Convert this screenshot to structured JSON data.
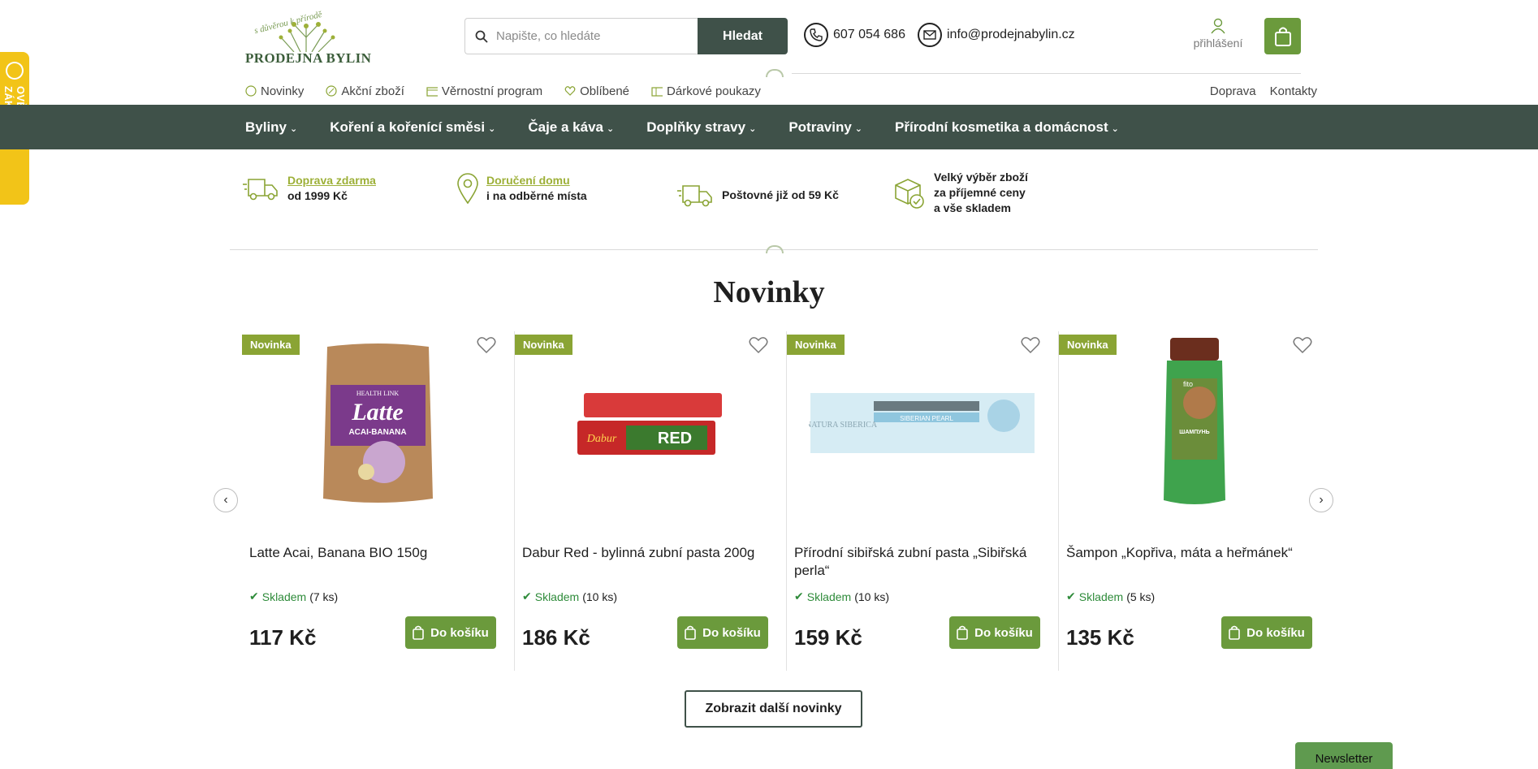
{
  "verified_tab": {
    "label": "OVĚŘENO ZÁKAZNÍKY"
  },
  "logo": {
    "name": "PRODEJNA BYLIN",
    "motto": "s důvěrou k přírodě"
  },
  "search": {
    "placeholder": "Napište, co hledáte",
    "button": "Hledat"
  },
  "contact": {
    "phone": "607 054 686",
    "email": "info@prodejnabylin.cz"
  },
  "login": {
    "label": "přihlášení"
  },
  "subnav": {
    "items": [
      {
        "label": "Novinky",
        "icon": "new-icon"
      },
      {
        "label": "Akční zboží",
        "icon": "percent-icon"
      },
      {
        "label": "Věrnostní program",
        "icon": "loyalty-icon"
      },
      {
        "label": "Oblíbené",
        "icon": "heart-icon"
      },
      {
        "label": "Dárkové poukazy",
        "icon": "voucher-icon"
      }
    ],
    "right": [
      "Doprava",
      "Kontakty"
    ]
  },
  "mainnav": {
    "items": [
      "Byliny",
      "Koření a kořenící směsi",
      "Čaje a káva",
      "Doplňky stravy",
      "Potraviny",
      "Přírodní kosmetika a domácnost"
    ]
  },
  "benefits": [
    {
      "link": "Doprava zdarma",
      "text": "od 1999 Kč",
      "icon": "truck-icon"
    },
    {
      "link": "Doručení domu",
      "text": "i na odběrné místa",
      "icon": "location-pin-icon"
    },
    {
      "text": "Poštovné již od 59 Kč",
      "icon": "truck-icon"
    },
    {
      "line1": "Velký výběr zboží",
      "line2": "za příjemné ceny",
      "line3": "a vše skladem",
      "icon": "box-check-icon"
    }
  ],
  "section": {
    "title": "Novinky"
  },
  "products": [
    {
      "badge": "Novinka",
      "name": "Latte Acai, Banana BIO 150g",
      "stock_label": "Skladem",
      "stock_qty": "(7 ks)",
      "price": "117 Kč",
      "button": "Do košíku",
      "image_text": "Latte",
      "image_sub": "ACAI-BANANA",
      "image_brand": "HEALTH LINK"
    },
    {
      "badge": "Novinka",
      "name": "Dabur Red - bylinná zubní pasta 200g",
      "stock_label": "Skladem",
      "stock_qty": "(10 ks)",
      "price": "186 Kč",
      "button": "Do košíku",
      "image_text": "RED",
      "image_brand": "Dabur"
    },
    {
      "badge": "Novinka",
      "name": "Přírodní sibiřská zubní pasta „Sibiřská perla“",
      "stock_label": "Skladem",
      "stock_qty": "(10 ks)",
      "price": "159 Kč",
      "button": "Do košíku",
      "image_text": "SIBERIAN PEARL",
      "image_brand": "NATURA SIBERICA"
    },
    {
      "badge": "Novinka",
      "name": "Šampon „Kopřiva, máta a heřmánek“",
      "stock_label": "Skladem",
      "stock_qty": "(5 ks)",
      "price": "135 Kč",
      "button": "Do košíku",
      "image_text": "ШАМПУНЬ",
      "image_brand": "fito"
    }
  ],
  "more_button": "Zobrazit další novinky",
  "newsletter": "Newsletter",
  "colors": {
    "primary_dark": "#3f5149",
    "accent_green": "#6b9a3c",
    "badge_green": "#8aa434",
    "link_green": "#9db038",
    "yellow": "#f2c418"
  }
}
